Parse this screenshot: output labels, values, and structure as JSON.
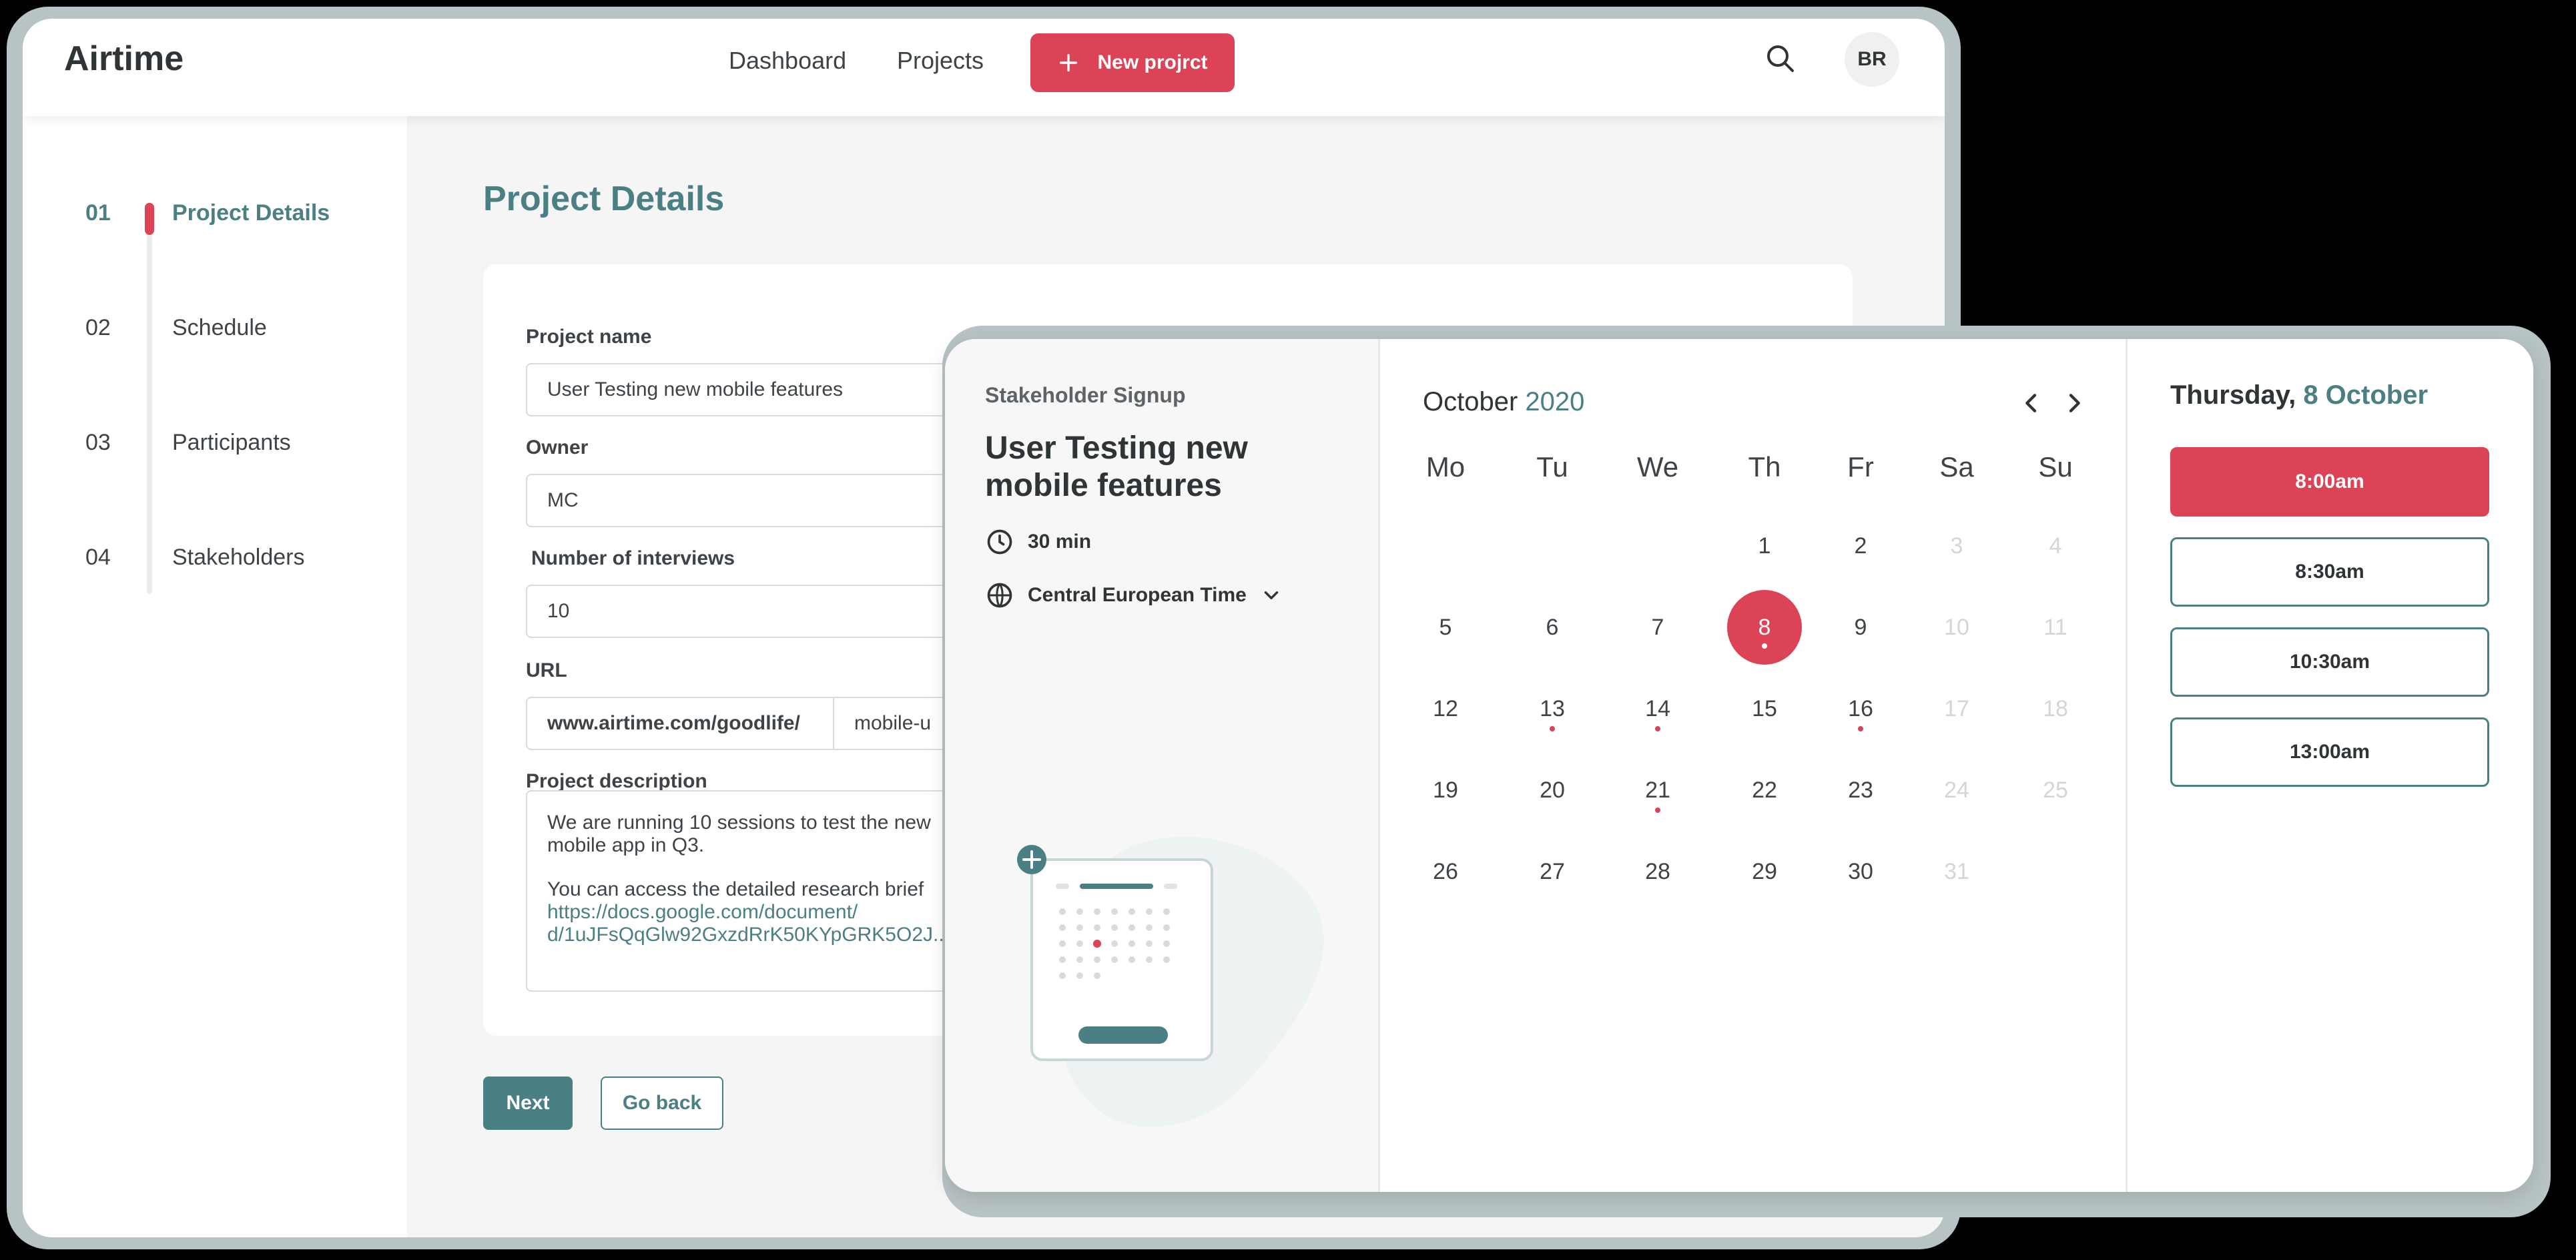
{
  "app": {
    "logo": "Airtime",
    "nav": {
      "dashboard": "Dashboard",
      "projects": "Projects"
    },
    "new_project_label": "New projrct",
    "avatar_initials": "BR"
  },
  "steps": [
    {
      "num": "01",
      "label": "Project Details",
      "active": true
    },
    {
      "num": "02",
      "label": "Schedule",
      "active": false
    },
    {
      "num": "03",
      "label": "Participants",
      "active": false
    },
    {
      "num": "04",
      "label": "Stakeholders",
      "active": false
    }
  ],
  "form": {
    "title": "Project Details",
    "project_name_label": "Project name",
    "project_name_value": "User Testing new mobile features",
    "owner_label": "Owner",
    "owner_value": "MC",
    "interviews_label": "Number of interviews",
    "interviews_value": "10",
    "url_label": "URL",
    "url_prefix": "www.airtime.com/goodlife/",
    "url_slug": "mobile-u",
    "description_label": "Project description",
    "description_line1": "We are running 10 sessions to test the new",
    "description_line2": "mobile app in Q3.",
    "description_line3": "You can access the detailed research brief",
    "description_link1": "https://docs.google.com/document/",
    "description_link2": "d/1uJFsQqGlw92GxzdRrK50KYpGRK5O2J...",
    "next_label": "Next",
    "back_label": "Go back"
  },
  "booking": {
    "eyebrow": "Stakeholder Signup",
    "title": "User Testing new mobile features",
    "duration": "30 min",
    "timezone": "Central European Time",
    "month": "October",
    "year": "2020",
    "weekdays": [
      "Mo",
      "Tu",
      "We",
      "Th",
      "Fr",
      "Sa",
      "Su"
    ],
    "leading_blanks": 3,
    "days_in_month": 31,
    "weekend_faded": true,
    "selected_day": 8,
    "days_with_availability": [
      8,
      13,
      14,
      16,
      21
    ],
    "selected_date_weekday": "Thursday,",
    "selected_date_label": "8 October",
    "time_slots": [
      "8:00am",
      "8:30am",
      "10:30am",
      "13:00am"
    ],
    "selected_slot_index": 0
  },
  "colors": {
    "accent": "#dc4356",
    "primary": "#4a7f84",
    "frame": "#b8c3c5"
  }
}
